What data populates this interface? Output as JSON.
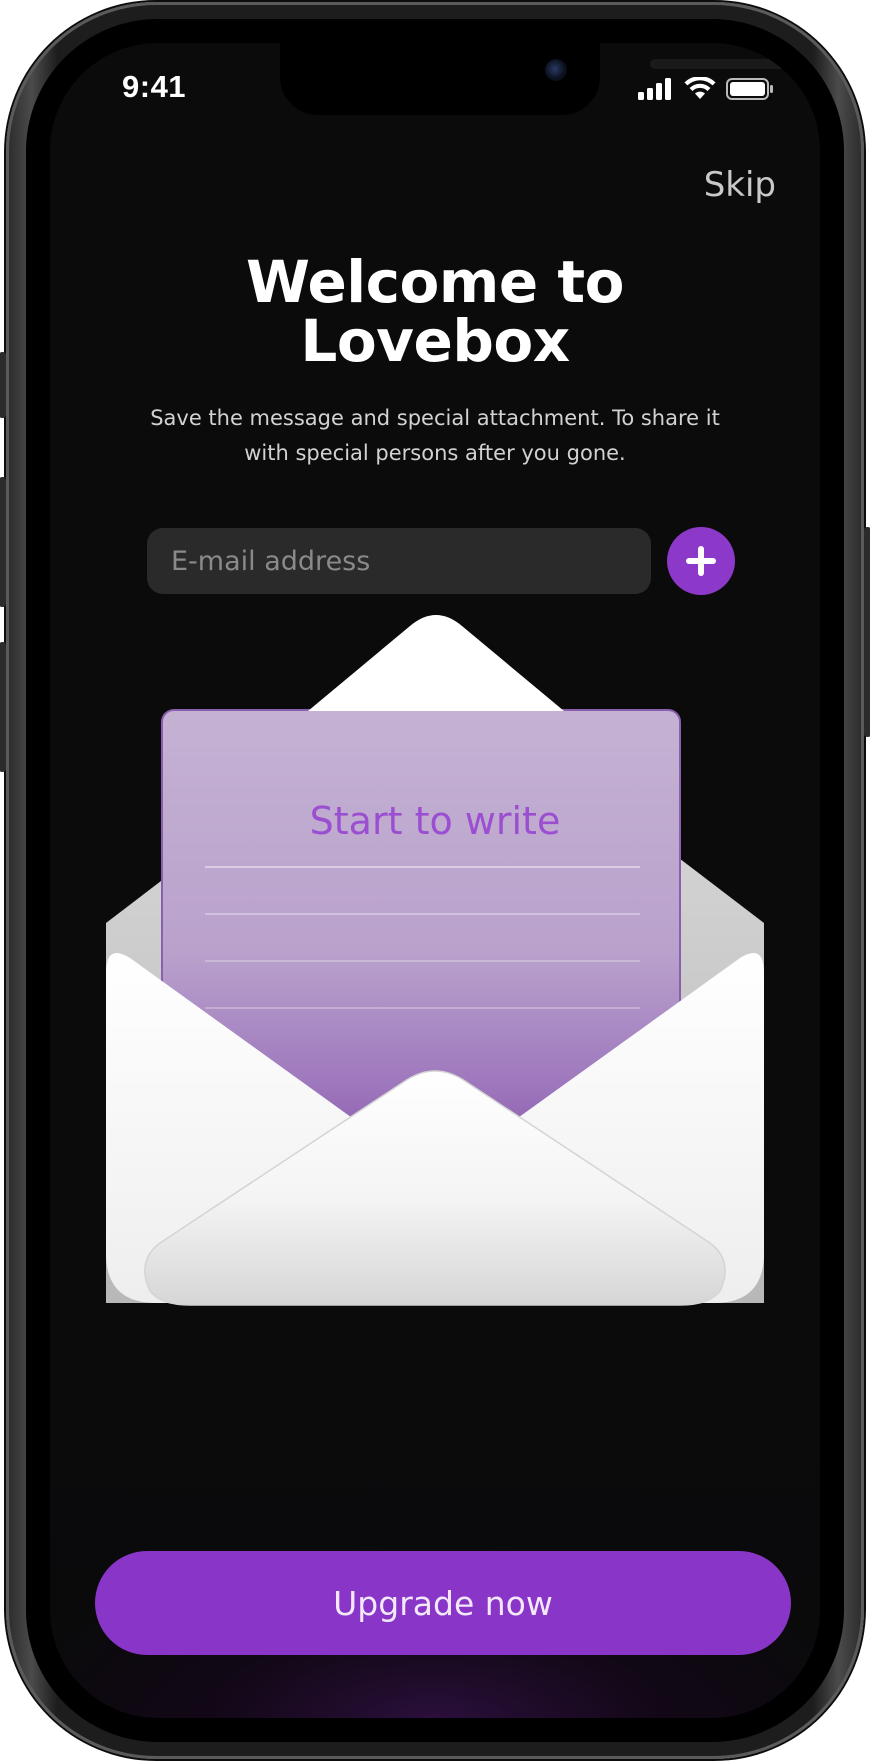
{
  "status_bar": {
    "time": "9:41"
  },
  "header": {
    "skip_label": "Skip"
  },
  "welcome": {
    "title_line1": "Welcome to",
    "title_line2": "Lovebox",
    "subtitle": "Save the message and special attachment. To share it with special persons after you gone."
  },
  "email": {
    "placeholder": "E-mail address",
    "value": ""
  },
  "letter": {
    "title": "Start to write"
  },
  "cta": {
    "label": "Upgrade now"
  },
  "icons": {
    "add": "plus-icon",
    "signal": "cellular-signal-icon",
    "wifi": "wifi-icon",
    "battery": "battery-icon"
  },
  "colors": {
    "accent": "#8935C8",
    "background": "#0B0B0C",
    "letter": "#C4B0D2",
    "envelope": "#FFFFFF"
  }
}
